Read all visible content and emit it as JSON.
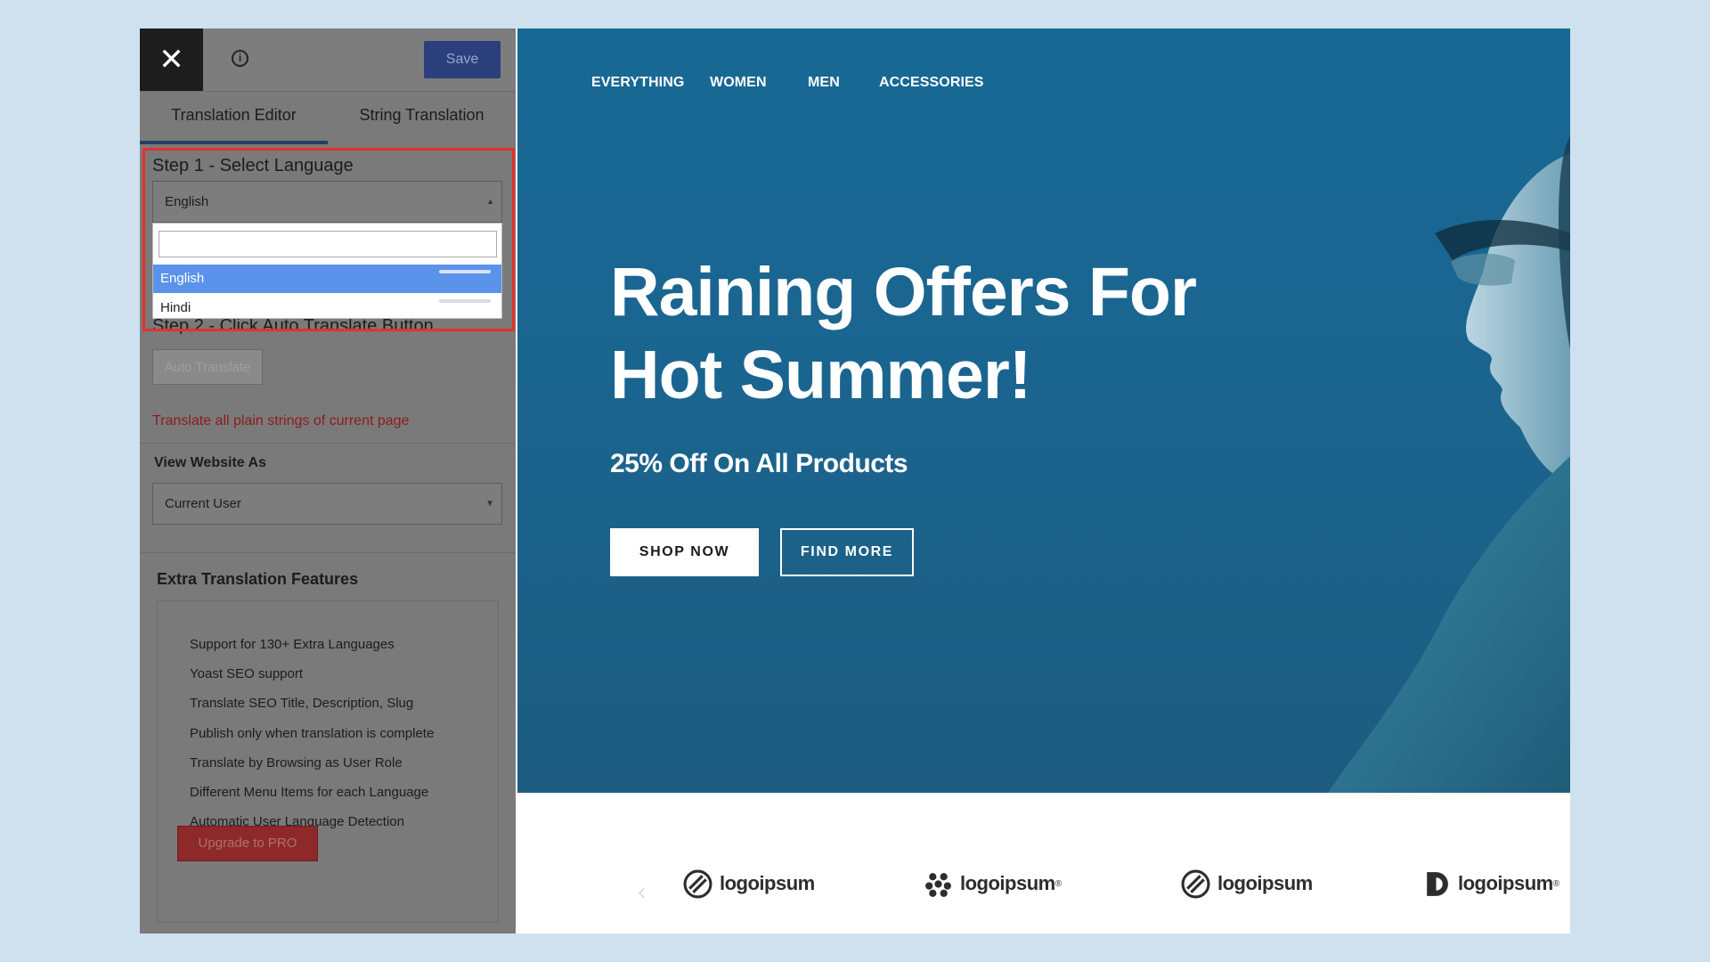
{
  "panel": {
    "close_glyph": "✕",
    "info_glyph": "i",
    "save_label": "Save",
    "tabs": [
      {
        "label": "Translation Editor",
        "active": true
      },
      {
        "label": "String Translation",
        "active": false
      }
    ],
    "step1_label": "Step 1 - Select Language",
    "language_select": {
      "value": "English",
      "search_value": "",
      "options": [
        {
          "label": "English",
          "selected": true
        },
        {
          "label": "Hindi",
          "selected": false
        }
      ]
    },
    "step2_label": "Step 2 - Click Auto Translate Button",
    "auto_translate_label": "Auto Translate",
    "auto_translate_note": "Translate all plain strings of current page",
    "view_as_label": "View Website As",
    "view_as_value": "Current User",
    "extra_title": "Extra Translation Features",
    "features": [
      "Support for 130+ Extra Languages",
      "Yoast SEO support",
      "Translate SEO Title, Description, Slug",
      "Publish only when translation is complete",
      "Translate by Browsing as User Role",
      "Different Menu Items for each Language",
      "Automatic User Language Detection"
    ],
    "upgrade_label": "Upgrade to PRO"
  },
  "site": {
    "nav": [
      "EVERYTHING",
      "WOMEN",
      "MEN",
      "ACCESSORIES"
    ],
    "headline_line1": "Raining Offers For",
    "headline_line2": "Hot Summer!",
    "subhead": "25% Off On All Products",
    "shop_now": "SHOP NOW",
    "find_more": "FIND MORE",
    "logos": [
      {
        "text": "logoipsum",
        "icon": "circle-slash-logo-icon"
      },
      {
        "text": "logoipsum",
        "trademark": "®",
        "icon": "dots-cluster-logo-icon"
      },
      {
        "text": "logoipsum",
        "icon": "circle-slash-logo-icon"
      },
      {
        "text": "logoipsum",
        "trademark": "®",
        "icon": "half-moon-logo-icon"
      }
    ],
    "arrow_left": "‹"
  },
  "colors": {
    "hero_blue": "#186895",
    "save_blue": "#2b3f7c",
    "highlight_red": "#e5312b",
    "selected_option": "#5b93eb",
    "upgrade_red": "#8e2929"
  }
}
